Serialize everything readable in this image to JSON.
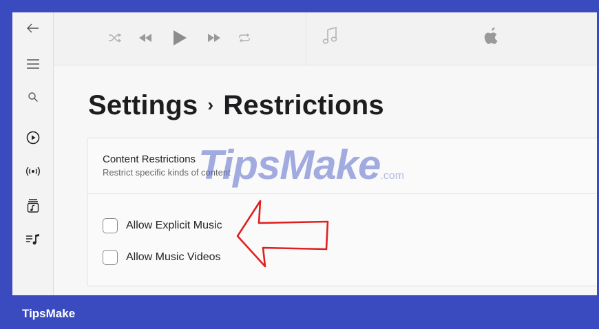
{
  "colors": {
    "frame": "#3a4bc0",
    "window_bg": "#f5f5f5",
    "annotation_arrow": "#e02020",
    "watermark": "#5a69c8"
  },
  "sidebar": {
    "items": [
      {
        "name": "back",
        "icon": "arrow-left-icon"
      },
      {
        "name": "menu",
        "icon": "hamburger-icon"
      },
      {
        "name": "search",
        "icon": "search-icon"
      },
      {
        "name": "listen-now",
        "icon": "play-circle-icon"
      },
      {
        "name": "radio",
        "icon": "radio-broadcast-icon"
      },
      {
        "name": "library",
        "icon": "library-icon"
      },
      {
        "name": "playlists",
        "icon": "playlist-icon"
      }
    ]
  },
  "toolbar": {
    "controls": [
      "shuffle-icon",
      "rewind-icon",
      "play-icon",
      "fast-forward-icon",
      "repeat-icon"
    ],
    "now_playing_icon": "music-note-icon",
    "brand_icon": "apple-logo-icon"
  },
  "page": {
    "title": "Settings",
    "separator": "›",
    "subtitle": "Restrictions"
  },
  "content_restrictions": {
    "title": "Content Restrictions",
    "description": "Restrict specific kinds of content",
    "options": [
      {
        "label": "Allow Explicit Music",
        "checked": false
      },
      {
        "label": "Allow Music Videos",
        "checked": false
      }
    ]
  },
  "watermark": {
    "text": "TipsMake",
    "suffix": ".com"
  },
  "footer": {
    "brand": "TipsMake"
  }
}
